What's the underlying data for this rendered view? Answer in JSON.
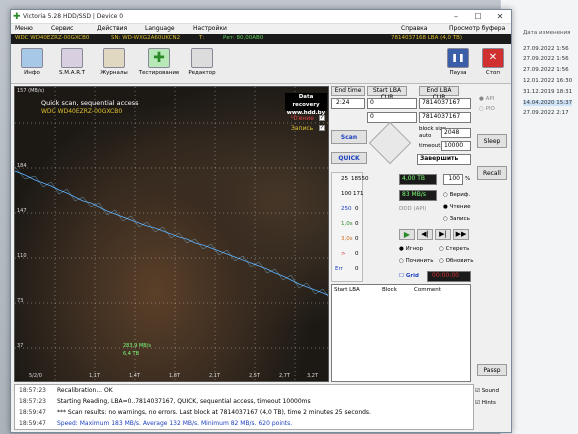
{
  "title": "Victoria 5.28 HDD/SSD | Device 0",
  "menu": [
    "Меню",
    "Сервис",
    "Действия",
    "Language",
    "Настройки",
    "Справка",
    "Просмотр буфера"
  ],
  "device": {
    "model": "WDC WD40EZRZ-00GXCB0",
    "serial": "SN: WD-WXG2A60UKCN2",
    "temp": "Т:",
    "hours": "Рет: 80,00АВ0",
    "lba": "7814037168 LBA (4,0 TB)"
  },
  "toolbar": [
    "Инфо",
    "S.M.A.R.T",
    "Журналы",
    "Тестирование",
    "Редактор",
    "Пауза",
    "Стоп"
  ],
  "graph": {
    "title": "Quick scan, sequential access",
    "model": "WDC WD40EZRZ-00GXCB0",
    "badge1": "Data recovery",
    "badge2": "www.hdd.by",
    "read": "Чтение",
    "write": "Запись",
    "speed": "283,9 MB/s",
    "size": "6,4 TB",
    "y": [
      "157 (MB/s)",
      "184",
      "147",
      "110",
      "73",
      "37"
    ],
    "x": [
      "5/2/0",
      "1,1T",
      "1,4T",
      "1,8T",
      "2,1T",
      "2,5T",
      "2,7T",
      "3,2T"
    ]
  },
  "panel": {
    "end_time_label": "End time",
    "start_lba_label": "Start LBA",
    "end_lba_label": "End LBA",
    "cur": "CUR",
    "max": "MAX",
    "end_time": "2:24",
    "start_lba": "0",
    "end_lba": "7814037167",
    "cur_lba": "0",
    "max_lba": "7814037167",
    "block_size_label": "block size",
    "auto": "auto",
    "block_size": "2048",
    "timeout_label": "timeout,ms",
    "timeout": "10000",
    "scan": "Scan",
    "quick": "QUICK",
    "action": "Завершить",
    "counts": [
      {
        "t": "25",
        "v": "18550"
      },
      {
        "t": "100",
        "v": "171"
      },
      {
        "t": "250",
        "v": "0"
      },
      {
        "t": "1,0s",
        "v": "0"
      },
      {
        "t": "3,0s",
        "v": "0"
      },
      {
        "t": ">",
        "v": "0"
      },
      {
        "t": "Err",
        "v": "0"
      }
    ],
    "size": "4,00 TB",
    "pct": "100",
    "pct_unit": "%",
    "speed": "83 MB/s",
    "verify": "Вериф.",
    "read": "Чтение",
    "write": "Запись",
    "ddd": "DDD (API)",
    "ignore": "Игнор",
    "erase": "Стереть",
    "fix": "Починить",
    "refresh": "Обновить",
    "grid": "Grid",
    "timer": "00:00:00",
    "table": [
      "Start LBA",
      "Block",
      "Comment"
    ]
  },
  "rside": {
    "api": "API",
    "pio": "PIO",
    "sleep": "Sleep",
    "recall": "Recall",
    "passp": "Passp",
    "sound": "Sound",
    "hints": "Hints"
  },
  "log": [
    {
      "t": "18:57:23",
      "m": "Recalibration... OK",
      "c": ""
    },
    {
      "t": "18:57:23",
      "m": "Starting Reading, LBA=0..7814037167, QUICK, sequential access, timeout 10000ms",
      "c": ""
    },
    {
      "t": "18:59:47",
      "m": "*** Scan results: no warnings, no errors. Last block at 7814037167 (4,0 TB), time 2 minutes 25 seconds.",
      "c": ""
    },
    {
      "t": "18:59:47",
      "m": "Speed: Maximum 183 MB/s. Average 132 MB/s. Minimum 82 MB/s. 620 points.",
      "c": "blue"
    }
  ],
  "explorer": {
    "header": "Дата изменения",
    "rows": [
      "27.09.2022 1:56",
      "27.09.2022 1:56",
      "27.09.2022 1:56",
      "12.01.2022 16:30",
      "31.12.2019 18:31",
      "14.04.2020 15:37",
      "27.09.2022 2:17"
    ]
  }
}
